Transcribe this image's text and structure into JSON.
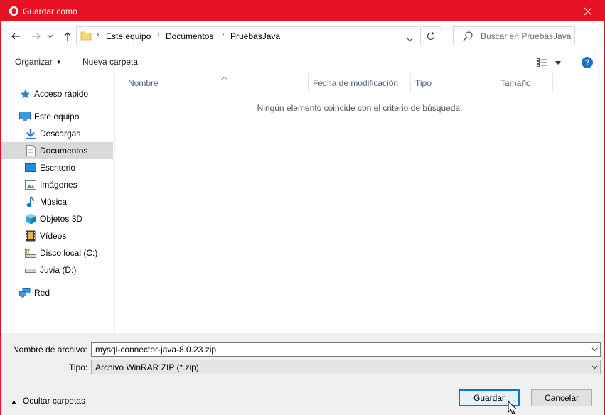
{
  "window": {
    "title": "Guardar como",
    "accent_color": "#e81123",
    "close_icon": "close-icon"
  },
  "nav": {
    "back_icon": "arrow-left-icon",
    "forward_icon": "arrow-right-icon",
    "history_icon": "chevron-down-icon",
    "up_icon": "arrow-up-icon",
    "breadcrumbs": [
      "Este equipo",
      "Documentos",
      "PruebasJava"
    ],
    "refresh_icon": "refresh-icon",
    "search_placeholder": "Buscar en PruebasJava"
  },
  "toolbar": {
    "organize_label": "Organizar",
    "new_folder_label": "Nueva carpeta",
    "view_icon": "details-view-icon",
    "help_label": "?"
  },
  "sidebar": {
    "items": [
      {
        "label": "Acceso rápido",
        "icon": "star-icon"
      },
      {
        "label": "Este equipo",
        "icon": "computer-icon"
      },
      {
        "label": "Descargas",
        "icon": "download-icon"
      },
      {
        "label": "Documentos",
        "icon": "document-icon",
        "selected": true
      },
      {
        "label": "Escritorio",
        "icon": "desktop-icon"
      },
      {
        "label": "Imágenes",
        "icon": "image-icon"
      },
      {
        "label": "Música",
        "icon": "music-icon"
      },
      {
        "label": "Objetos 3D",
        "icon": "cube-icon"
      },
      {
        "label": "Vídeos",
        "icon": "video-icon"
      },
      {
        "label": "Disco local (C:)",
        "icon": "local-disk-icon"
      },
      {
        "label": "Juvia (D:)",
        "icon": "drive-icon"
      },
      {
        "label": "Red",
        "icon": "network-icon"
      }
    ]
  },
  "filelist": {
    "columns": [
      "Nombre",
      "Fecha de modificación",
      "Tipo",
      "Tamaño"
    ],
    "empty_message": "Ningún elemento coincide con el criterio de búsqueda."
  },
  "bottom": {
    "filename_label": "Nombre de archivo:",
    "filename_value": "mysql-connector-java-8.0.23.zip",
    "filetype_label": "Tipo:",
    "filetype_value": "Archivo WinRAR ZIP (*.zip)",
    "hide_folders_label": "Ocultar carpetas",
    "save_label": "Guardar",
    "cancel_label": "Cancelar"
  }
}
